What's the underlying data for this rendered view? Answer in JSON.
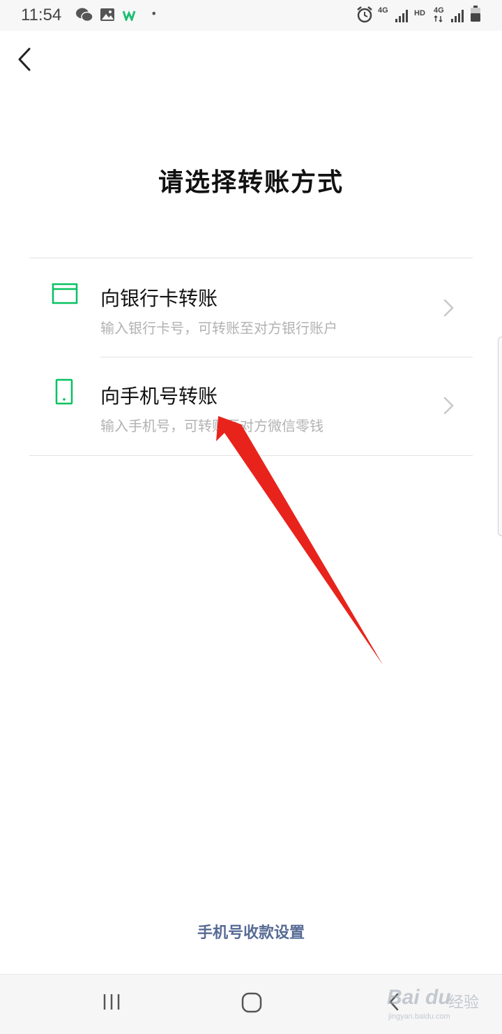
{
  "status_bar": {
    "time": "11:54",
    "network_label_1": "4G",
    "hd_label": "HD",
    "network_label_2": "4G"
  },
  "page": {
    "title": "请选择转账方式"
  },
  "options": [
    {
      "title": "向银行卡转账",
      "description": "输入银行卡号，可转账至对方银行账户",
      "icon": "bank-card-icon"
    },
    {
      "title": "向手机号转账",
      "description": "输入手机号，可转账至对方微信零钱",
      "icon": "mobile-phone-icon"
    }
  ],
  "footer": {
    "link_label": "手机号收款设置"
  },
  "watermark": {
    "brand": "Bai du",
    "label": "经验",
    "url": "jingyan.baidu.com"
  },
  "colors": {
    "accent_green": "#07c160",
    "link_blue": "#576b95",
    "annotation_red": "#e8231c"
  }
}
